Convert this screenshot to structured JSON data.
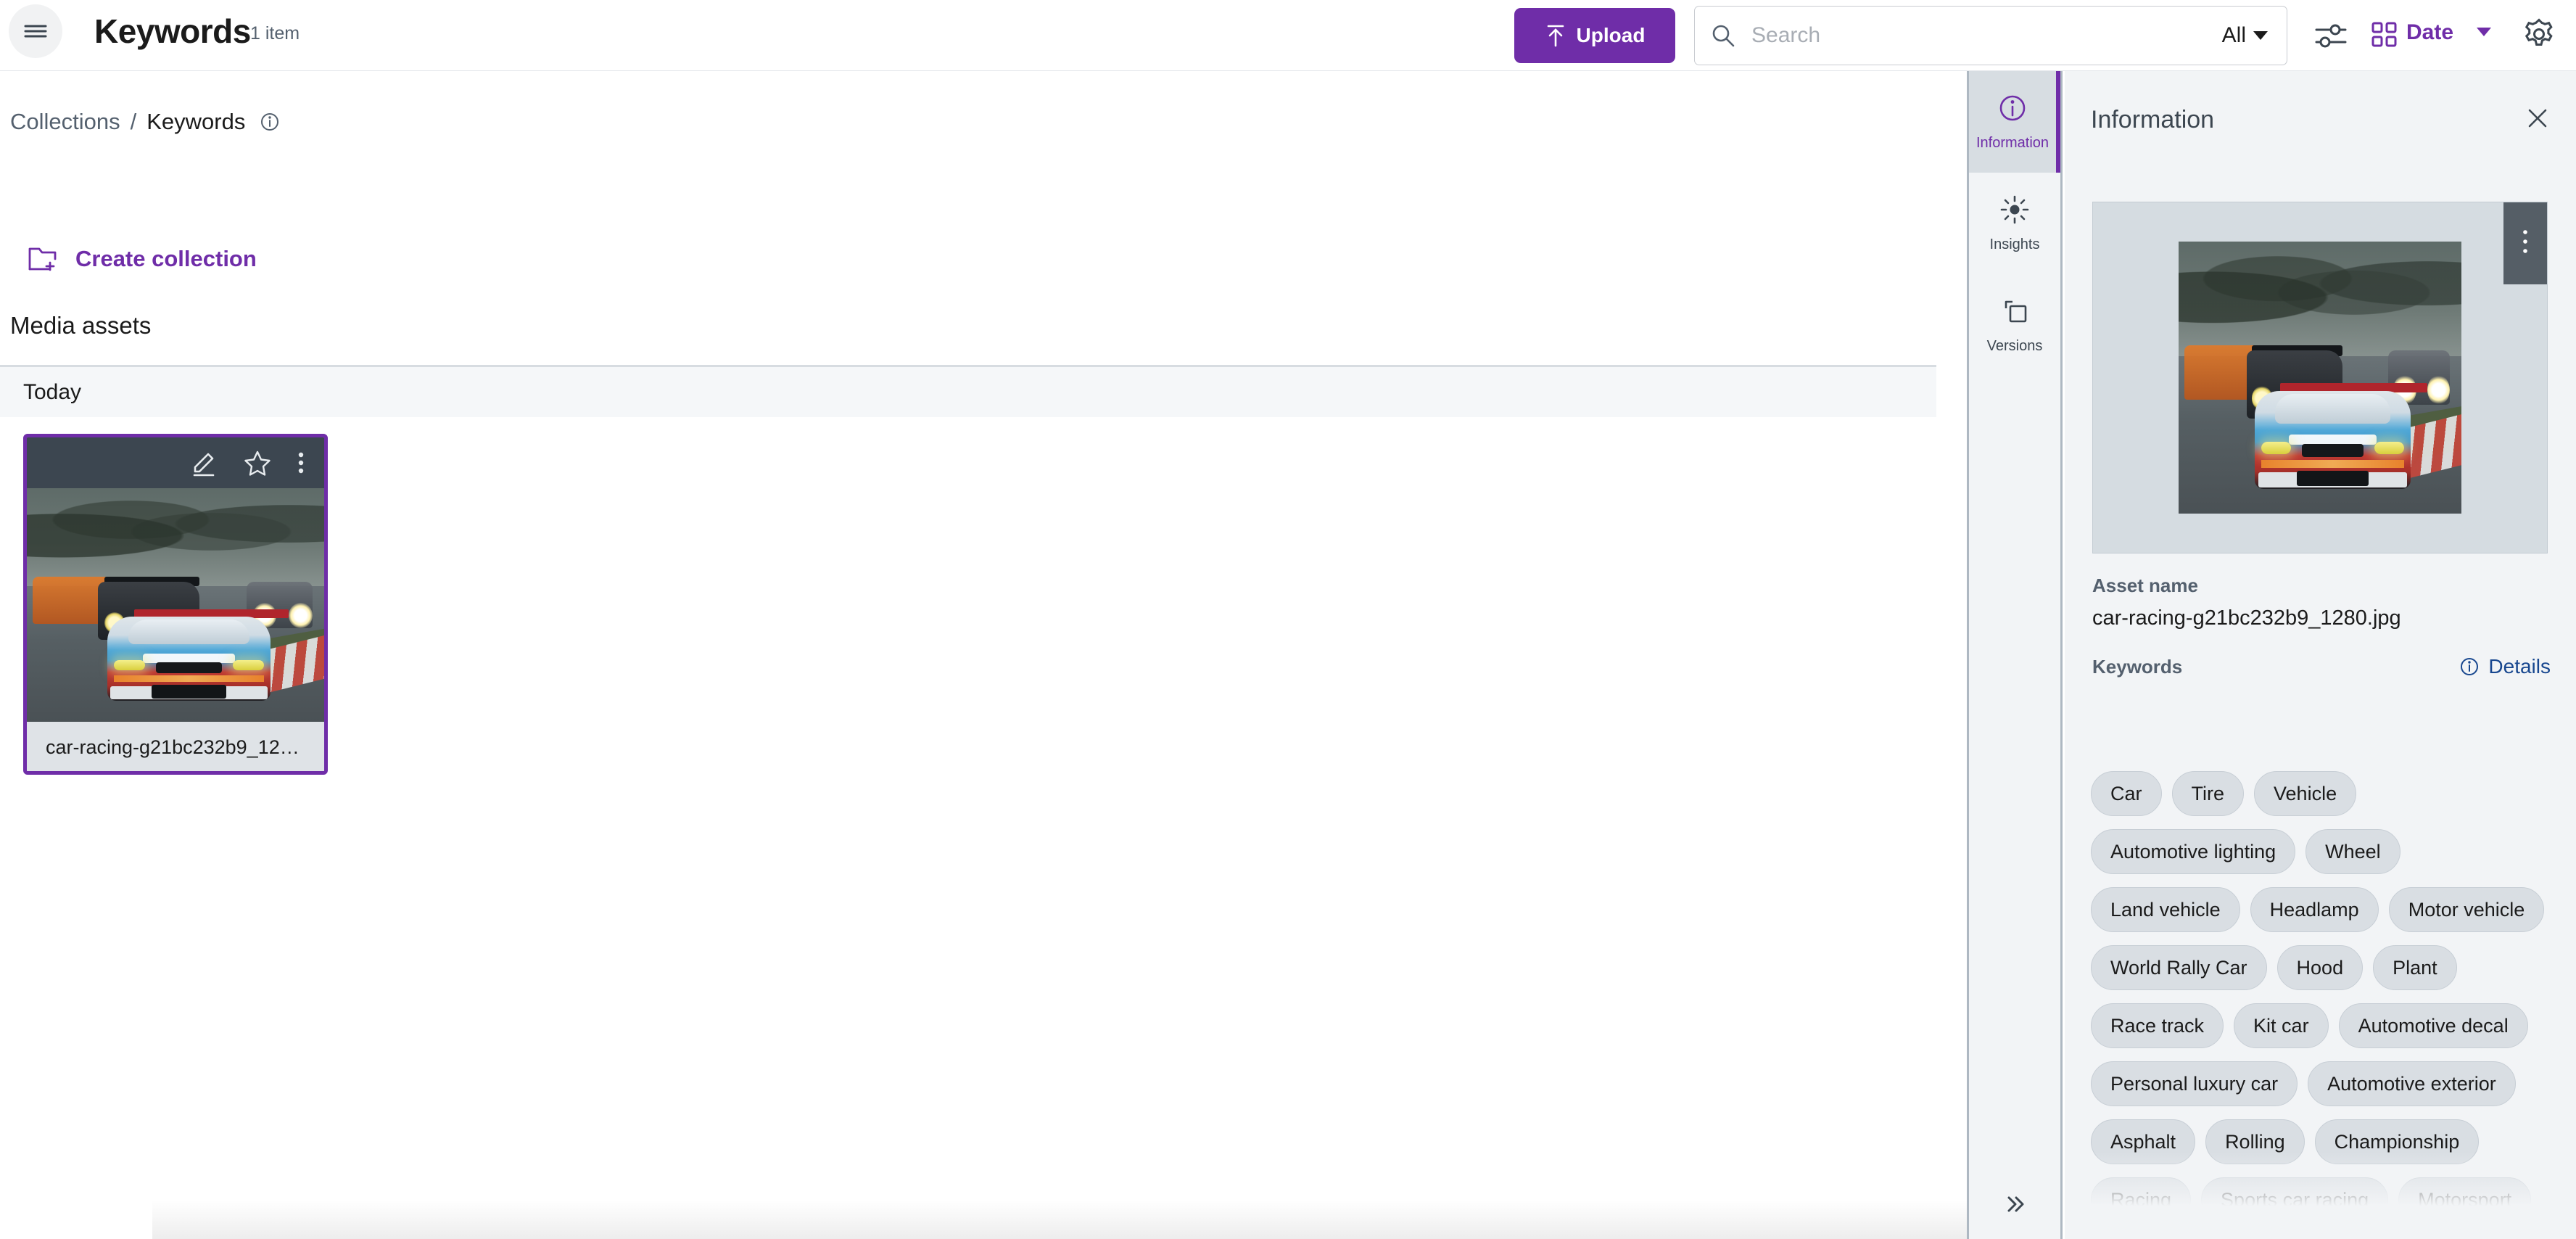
{
  "header": {
    "menu_icon": "hamburger-icon",
    "title": "Keywords",
    "count": "1 item",
    "upload_label": "Upload",
    "upload_icon": "upload-arrow-icon",
    "search_placeholder": "Search",
    "search_value": "",
    "search_icon": "search-icon",
    "search_scope": "All",
    "filters_icon": "sliders-icon",
    "grid_icon": "grid-view-icon",
    "sort_label": "Date",
    "settings_icon": "gear-icon",
    "accent_color": "#6f2da8"
  },
  "breadcrumb": {
    "root": "Collections",
    "separator": "/",
    "current": "Keywords",
    "info_icon": "info-circle-icon"
  },
  "actions": {
    "create_collection_label": "Create collection",
    "create_collection_icon": "folder-plus-icon"
  },
  "content": {
    "section_title": "Media assets",
    "group_label": "Today",
    "asset": {
      "name_truncated": "car-racing-g21bc232b9_12…",
      "edit_icon": "pencil-icon",
      "favorite_icon": "star-outline-icon",
      "more_icon": "kebab-menu-icon",
      "selected": true
    }
  },
  "rail": {
    "items": [
      {
        "label": "Information",
        "icon": "info-circle-icon",
        "active": true
      },
      {
        "label": "Insights",
        "icon": "sun-brightness-icon",
        "active": false
      },
      {
        "label": "Versions",
        "icon": "copy-layers-icon",
        "active": false
      }
    ],
    "expand_icon": "double-chevron-right-icon"
  },
  "panel": {
    "title": "Information",
    "close_icon": "close-x-icon",
    "preview_more_icon": "kebab-menu-icon",
    "asset_name_label": "Asset name",
    "asset_name_value": "car-racing-g21bc232b9_1280.jpg",
    "keywords_label": "Keywords",
    "details_label": "Details",
    "details_icon": "info-circle-icon",
    "keywords": [
      "Car",
      "Tire",
      "Vehicle",
      "Automotive lighting",
      "Wheel",
      "Land vehicle",
      "Headlamp",
      "Motor vehicle",
      "World Rally Car",
      "Hood",
      "Plant",
      "Race track",
      "Kit car",
      "Automotive decal",
      "Personal luxury car",
      "Automotive exterior",
      "Asphalt",
      "Rolling",
      "Championship",
      "Racing",
      "Sports car racing",
      "Motorsport"
    ]
  }
}
